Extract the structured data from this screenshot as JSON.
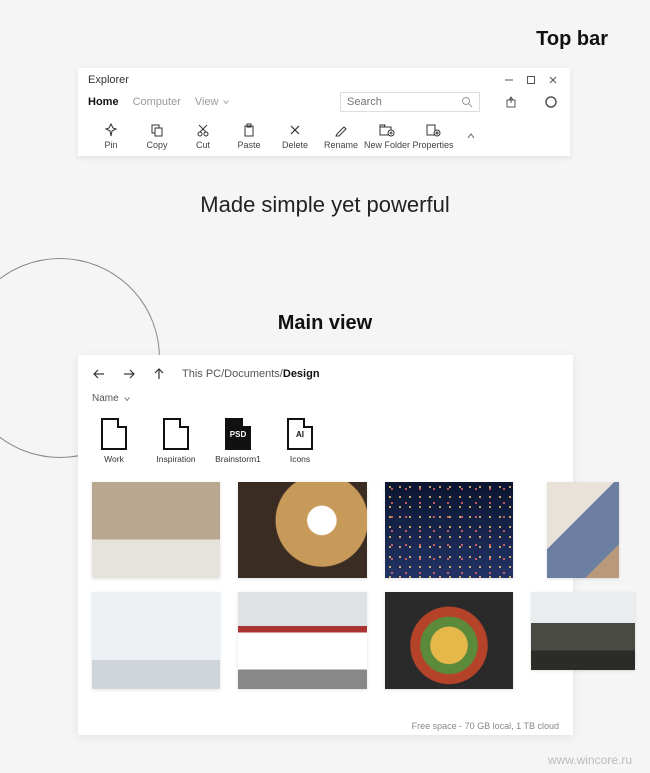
{
  "labels": {
    "topbar_heading": "Top bar",
    "tagline": "Made simple yet powerful",
    "mainview_heading": "Main view",
    "watermark": "www.wincore.ru"
  },
  "topbar": {
    "title": "Explorer",
    "tabs": {
      "home": "Home",
      "computer": "Computer",
      "view": "View"
    },
    "search_placeholder": "Search",
    "tools": {
      "pin": "Pin",
      "copy": "Copy",
      "cut": "Cut",
      "paste": "Paste",
      "delete": "Delete",
      "rename": "Rename",
      "newfolder": "New Folder",
      "properties": "Properties"
    }
  },
  "mainview": {
    "breadcrumb_prefix": "This PC/Documents/",
    "breadcrumb_current": "Design",
    "sort_label": "Name",
    "folders": {
      "work": "Work",
      "inspiration": "Inspiration",
      "brainstorm": "Brainstorm1",
      "icons": "Icons",
      "psd_badge": "PSD",
      "ai_badge": "AI"
    },
    "status": "Free space - 70 GB local, 1 TB cloud"
  }
}
